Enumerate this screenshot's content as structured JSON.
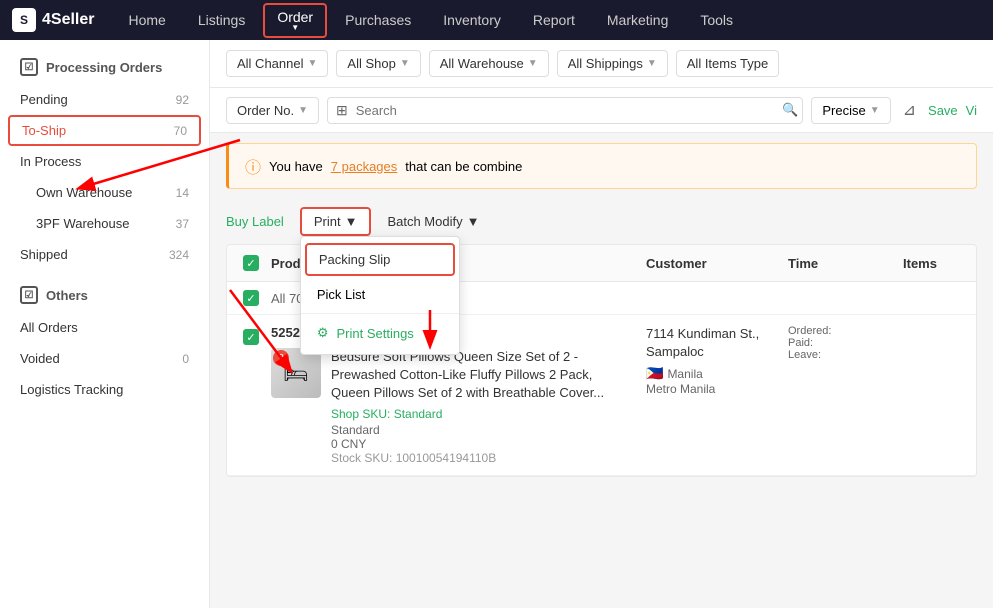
{
  "app": {
    "logo_text": "4Seller",
    "logo_icon": "S"
  },
  "nav": {
    "items": [
      {
        "label": "Home",
        "active": false
      },
      {
        "label": "Listings",
        "active": false
      },
      {
        "label": "Order",
        "active": true,
        "has_arrow": true
      },
      {
        "label": "Purchases",
        "active": false
      },
      {
        "label": "Inventory",
        "active": false
      },
      {
        "label": "Report",
        "active": false
      },
      {
        "label": "Marketing",
        "active": false
      },
      {
        "label": "Tools",
        "active": false
      }
    ]
  },
  "sidebar": {
    "sections": [
      {
        "label": "Processing Orders",
        "is_header": true,
        "icon": "checkbox"
      },
      {
        "label": "Pending",
        "badge": "92",
        "sub": false
      },
      {
        "label": "To-Ship",
        "badge": "70",
        "sub": false,
        "active": true
      },
      {
        "label": "In Process",
        "badge": "",
        "sub": false
      },
      {
        "label": "Own Warehouse",
        "badge": "14",
        "sub": true
      },
      {
        "label": "3PF Warehouse",
        "badge": "37",
        "sub": true
      },
      {
        "label": "Shipped",
        "badge": "324",
        "sub": false
      },
      {
        "label": "Others",
        "is_header": true,
        "icon": "checkbox"
      },
      {
        "label": "All Orders",
        "badge": "",
        "sub": false
      },
      {
        "label": "Voided",
        "badge": "0",
        "sub": false
      },
      {
        "label": "Logistics Tracking",
        "badge": "",
        "sub": false
      }
    ]
  },
  "filters": {
    "channel": {
      "label": "All Channel",
      "value": "All Channel"
    },
    "shop": {
      "label": "All Shop",
      "value": "All Shop"
    },
    "warehouse": {
      "label": "All Warehouse",
      "value": "All Warehouse"
    },
    "shippings": {
      "label": "All Shippings",
      "value": "All Shippings"
    },
    "items_type": {
      "label": "All Items Type",
      "value": "All Items Type"
    }
  },
  "search": {
    "order_field": {
      "label": "Order No.",
      "value": "Order No."
    },
    "placeholder": "Search",
    "precise": {
      "label": "Precise",
      "value": "Precise"
    },
    "save_label": "Save",
    "view_label": "Vi"
  },
  "notice": {
    "text_before": "You have ",
    "link_text": "7 packages",
    "text_after": " that can be combine"
  },
  "actions": {
    "buy_label": "Buy Label",
    "print": "Print",
    "batch_modify": "Batch Modify",
    "dropdown_items": [
      {
        "label": "Packing Slip",
        "highlighted": true
      },
      {
        "label": "Pick List",
        "highlighted": false
      },
      {
        "label": "Print Settings",
        "highlighted": false,
        "is_settings": true
      }
    ]
  },
  "table": {
    "headers": [
      "Products",
      "Customer",
      "Time",
      "Items"
    ],
    "all_orders_text": "All 70 orders",
    "order_no": "52521-10",
    "checkbox_icon": "✓",
    "product": {
      "badge": "2",
      "name": "Bedsure Soft Pillows Queen Size Set of 2 - Prewashed Cotton-Like Fluffy Pillows 2 Pack, Queen Pillows Set of 2 with Breathable Cover...",
      "sku_label": "Shop SKU: Standard",
      "standard": "Standard",
      "price": "0 CNY",
      "stock_sku": "Stock SKU: 10010054194110B"
    },
    "customer": {
      "address": "7114 Kundiman St., Sampaloc",
      "flag": "🇵🇭",
      "city": "Manila",
      "region": "Metro Manila"
    },
    "time": {
      "ordered": "Ordered:",
      "paid": "Paid:",
      "leave": "Leave:"
    }
  }
}
